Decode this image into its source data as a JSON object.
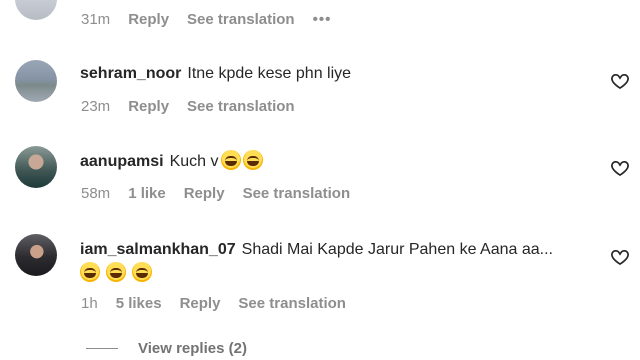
{
  "comments": [
    {
      "username": "",
      "text": "",
      "meta": {
        "time": "31m",
        "reply": "Reply",
        "translate": "See translation",
        "more": "•••"
      }
    },
    {
      "username": "sehram_noor",
      "text": "Itne kpde kese phn liye",
      "meta": {
        "time": "23m",
        "reply": "Reply",
        "translate": "See translation"
      }
    },
    {
      "username": "aanupamsi",
      "text": "Kuch v",
      "emojis": [
        "face-with-tears-of-joy",
        "face-with-tears-of-joy"
      ],
      "meta": {
        "time": "58m",
        "likes": "1 like",
        "reply": "Reply",
        "translate": "See translation"
      }
    },
    {
      "username": "iam_salmankhan_07",
      "text": "Shadi Mai Kapde Jarur Pahen ke Aana aa...",
      "emojis_line2": [
        "grinning-face",
        "rolling-on-floor-laughing",
        "rolling-on-floor-laughing"
      ],
      "meta": {
        "time": "1h",
        "likes": "5 likes",
        "reply": "Reply",
        "translate": "See translation"
      }
    }
  ],
  "view_replies": "View replies (2)",
  "icons": {
    "like": "heart-outline-icon",
    "more": "more-dots-icon"
  },
  "colors": {
    "text": "#262626",
    "secondary": "#8e8e8e",
    "background": "#ffffff"
  }
}
